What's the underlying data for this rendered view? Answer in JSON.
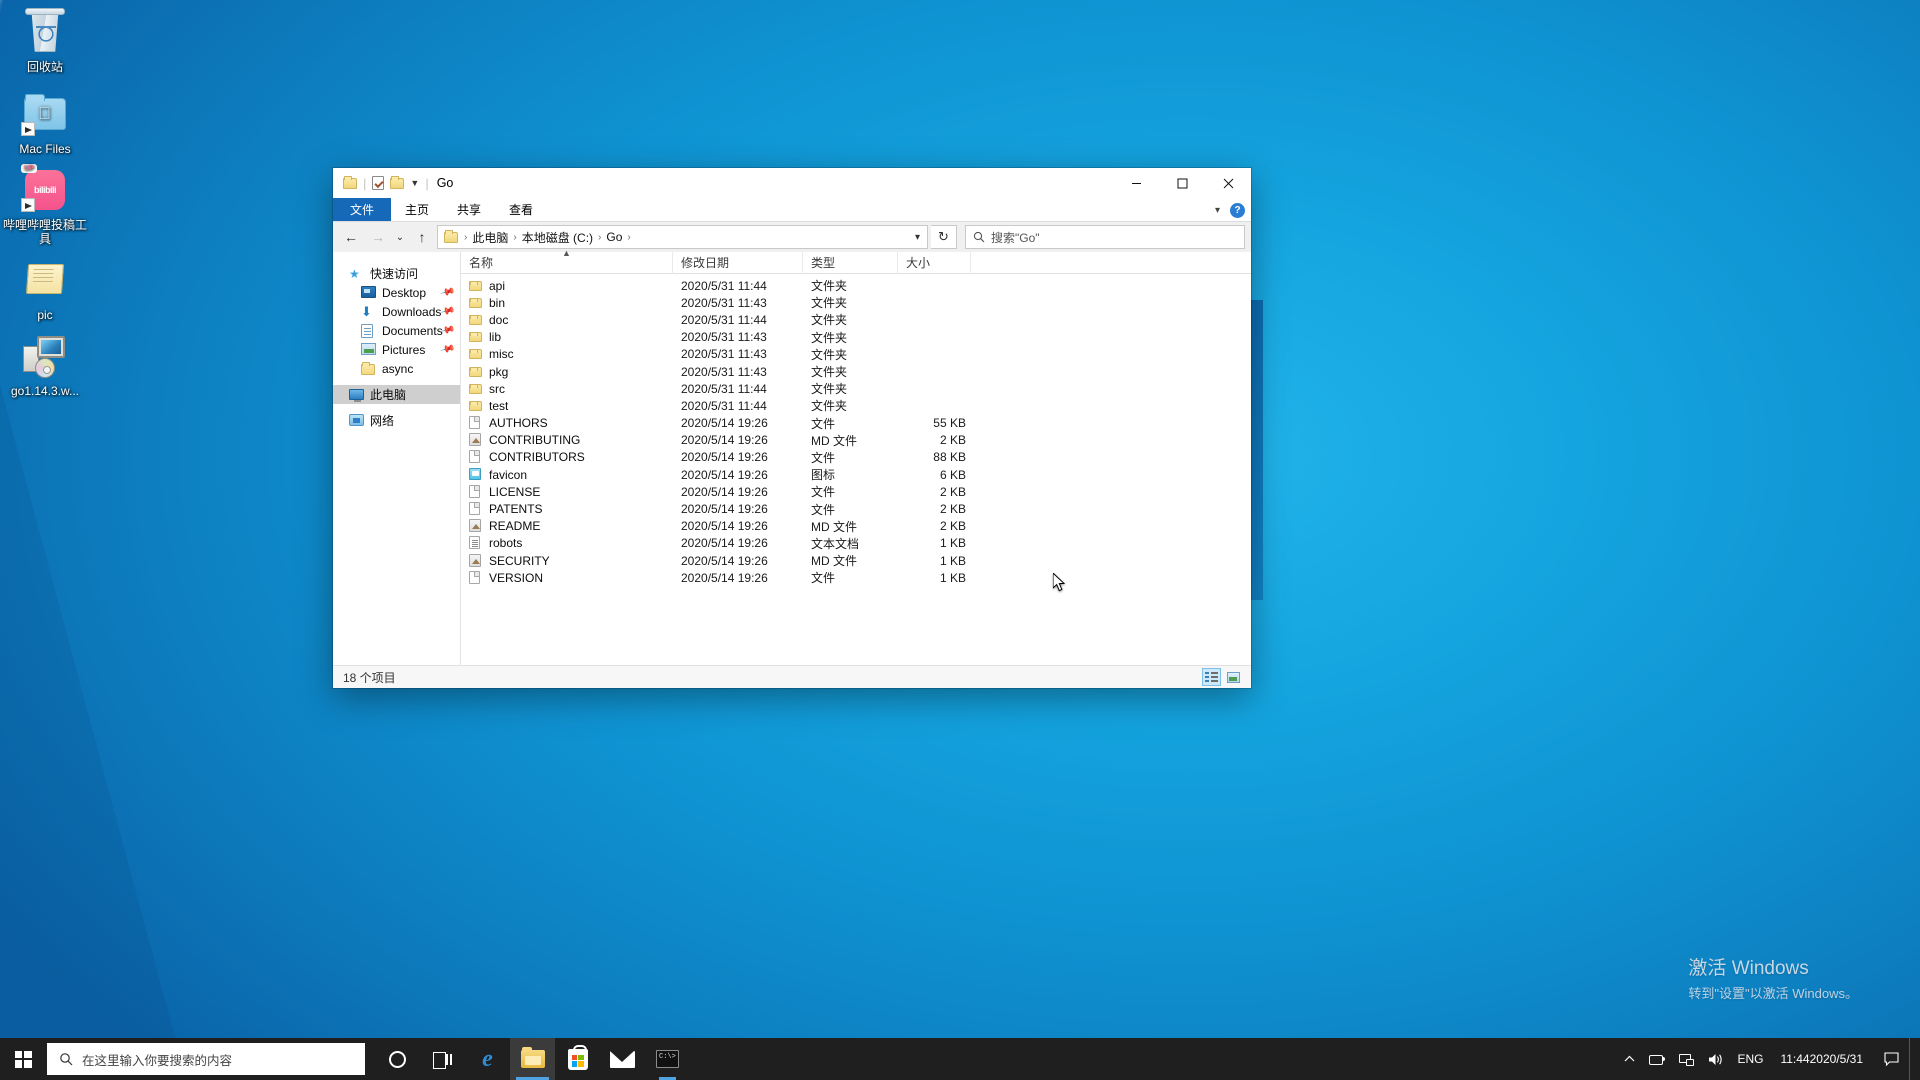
{
  "desktop": {
    "icons": [
      {
        "label": "回收站",
        "icon": "recycle-bin-icon",
        "shortcut": false
      },
      {
        "label": "Mac Files",
        "icon": "mac-files-folder-icon",
        "shortcut": true
      },
      {
        "label": "哔哩哔哩投稿工具",
        "icon": "bilibili-icon",
        "shortcut": true
      },
      {
        "label": "pic",
        "icon": "pic-folder-icon",
        "shortcut": false
      },
      {
        "label": "go1.14.3.w...",
        "icon": "installer-icon",
        "shortcut": false
      }
    ],
    "watermark": {
      "title": "激活 Windows",
      "subtitle": "转到\"设置\"以激活 Windows。"
    }
  },
  "explorer": {
    "title": "Go",
    "quick_access_toolbar": [
      {
        "name": "properties-button",
        "icon": "properties-icon"
      },
      {
        "name": "new-folder-button",
        "icon": "folder-icon"
      },
      {
        "name": "customize-qat-button",
        "icon": "chevron-down-icon"
      }
    ],
    "window_controls": {
      "minimize": "minimize-icon",
      "maximize": "maximize-icon",
      "close": "close-icon"
    },
    "ribbon": {
      "tabs": [
        {
          "label": "文件",
          "active": true
        },
        {
          "label": "主页",
          "active": false
        },
        {
          "label": "共享",
          "active": false
        },
        {
          "label": "查看",
          "active": false
        }
      ],
      "expand_icon": "chevron-down-icon",
      "help_label": "?"
    },
    "nav_buttons": {
      "back": "←",
      "forward": "→",
      "recent": "⌄",
      "up": "↑"
    },
    "breadcrumb": {
      "icon": "folder-icon",
      "items": [
        "此电脑",
        "本地磁盘 (C:)",
        "Go"
      ],
      "separator": "›",
      "dropdown_icon": "chevron-down-icon"
    },
    "refresh_icon": "↻",
    "search": {
      "icon": "search-icon",
      "placeholder": "搜索\"Go\""
    },
    "nav_pane": [
      {
        "label": "快速访问",
        "icon": "star-icon",
        "level": 0,
        "pinned": false,
        "selected": false
      },
      {
        "label": "Desktop",
        "icon": "desktop-icon",
        "level": 1,
        "pinned": true,
        "selected": false
      },
      {
        "label": "Downloads",
        "icon": "downloads-icon",
        "level": 1,
        "pinned": true,
        "selected": false
      },
      {
        "label": "Documents",
        "icon": "documents-icon",
        "level": 1,
        "pinned": true,
        "selected": false
      },
      {
        "label": "Pictures",
        "icon": "pictures-icon",
        "level": 1,
        "pinned": true,
        "selected": false
      },
      {
        "label": "async",
        "icon": "folder-icon",
        "level": 1,
        "pinned": false,
        "selected": false
      },
      {
        "label": "此电脑",
        "icon": "this-pc-icon",
        "level": 0,
        "pinned": false,
        "selected": true
      },
      {
        "label": "网络",
        "icon": "network-icon",
        "level": 0,
        "pinned": false,
        "selected": false
      }
    ],
    "columns": [
      {
        "key": "name",
        "label": "名称",
        "sorted": true,
        "sort_dir": "asc"
      },
      {
        "key": "date",
        "label": "修改日期",
        "sorted": false
      },
      {
        "key": "type",
        "label": "类型",
        "sorted": false
      },
      {
        "key": "size",
        "label": "大小",
        "sorted": false
      }
    ],
    "files": [
      {
        "name": "api",
        "date": "2020/5/31 11:44",
        "type": "文件夹",
        "size": "",
        "icon": "folder-icon"
      },
      {
        "name": "bin",
        "date": "2020/5/31 11:43",
        "type": "文件夹",
        "size": "",
        "icon": "folder-icon"
      },
      {
        "name": "doc",
        "date": "2020/5/31 11:44",
        "type": "文件夹",
        "size": "",
        "icon": "folder-icon"
      },
      {
        "name": "lib",
        "date": "2020/5/31 11:43",
        "type": "文件夹",
        "size": "",
        "icon": "folder-icon"
      },
      {
        "name": "misc",
        "date": "2020/5/31 11:43",
        "type": "文件夹",
        "size": "",
        "icon": "folder-icon"
      },
      {
        "name": "pkg",
        "date": "2020/5/31 11:43",
        "type": "文件夹",
        "size": "",
        "icon": "folder-icon"
      },
      {
        "name": "src",
        "date": "2020/5/31 11:44",
        "type": "文件夹",
        "size": "",
        "icon": "folder-icon"
      },
      {
        "name": "test",
        "date": "2020/5/31 11:44",
        "type": "文件夹",
        "size": "",
        "icon": "folder-icon"
      },
      {
        "name": "AUTHORS",
        "date": "2020/5/14 19:26",
        "type": "文件",
        "size": "55 KB",
        "icon": "file-icon"
      },
      {
        "name": "CONTRIBUTING",
        "date": "2020/5/14 19:26",
        "type": "MD 文件",
        "size": "2 KB",
        "icon": "md-file-icon"
      },
      {
        "name": "CONTRIBUTORS",
        "date": "2020/5/14 19:26",
        "type": "文件",
        "size": "88 KB",
        "icon": "file-icon"
      },
      {
        "name": "favicon",
        "date": "2020/5/14 19:26",
        "type": "图标",
        "size": "6 KB",
        "icon": "ico-file-icon"
      },
      {
        "name": "LICENSE",
        "date": "2020/5/14 19:26",
        "type": "文件",
        "size": "2 KB",
        "icon": "file-icon"
      },
      {
        "name": "PATENTS",
        "date": "2020/5/14 19:26",
        "type": "文件",
        "size": "2 KB",
        "icon": "file-icon"
      },
      {
        "name": "README",
        "date": "2020/5/14 19:26",
        "type": "MD 文件",
        "size": "2 KB",
        "icon": "md-file-icon"
      },
      {
        "name": "robots",
        "date": "2020/5/14 19:26",
        "type": "文本文档",
        "size": "1 KB",
        "icon": "txt-file-icon"
      },
      {
        "name": "SECURITY",
        "date": "2020/5/14 19:26",
        "type": "MD 文件",
        "size": "1 KB",
        "icon": "md-file-icon"
      },
      {
        "name": "VERSION",
        "date": "2020/5/14 19:26",
        "type": "文件",
        "size": "1 KB",
        "icon": "file-icon"
      }
    ],
    "status": {
      "item_count": "18 个项目"
    },
    "view_toggles": [
      {
        "name": "details-view-button",
        "icon": "details-view-icon",
        "active": true
      },
      {
        "name": "large-icons-view-button",
        "icon": "large-icons-view-icon",
        "active": false
      }
    ]
  },
  "taskbar": {
    "start_icon": "windows-logo-icon",
    "search": {
      "icon": "search-icon",
      "placeholder": "在这里输入你要搜索的内容"
    },
    "apps": [
      {
        "name": "cortana-button",
        "icon": "cortana-icon",
        "state": "idle"
      },
      {
        "name": "task-view-button",
        "icon": "task-view-icon",
        "state": "idle"
      },
      {
        "name": "edge-button",
        "icon": "edge-icon",
        "state": "idle"
      },
      {
        "name": "file-explorer-button",
        "icon": "folder-icon",
        "state": "active"
      },
      {
        "name": "microsoft-store-button",
        "icon": "store-icon",
        "state": "idle"
      },
      {
        "name": "mail-button",
        "icon": "mail-icon",
        "state": "idle"
      },
      {
        "name": "terminal-button",
        "icon": "terminal-icon",
        "state": "running"
      }
    ],
    "tray": {
      "overflow_icon": "chevron-up-icon",
      "usb_icon": "usb-device-icon",
      "network_icon": "network-icon",
      "volume_icon": "volume-icon",
      "language": "ENG",
      "time": "11:44",
      "date": "2020/5/31",
      "notification_icon": "notification-icon"
    }
  }
}
